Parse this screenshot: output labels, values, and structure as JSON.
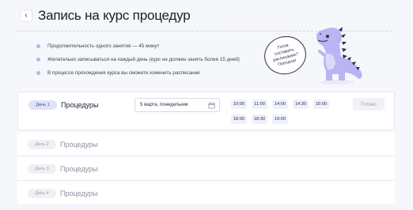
{
  "header": {
    "back_icon": "chevron-left-icon",
    "title": "Запись на курс процедур"
  },
  "info": [
    {
      "text": "Продолжительность одного занятия — 45 минут"
    },
    {
      "text": "Желательно записываться на каждый день  (курс не должен занять более 15 дней)"
    },
    {
      "text": "В процессе прохождения курса вы сможете изменить расписание"
    }
  ],
  "mascot": {
    "bubble_text": "Готов\nсоставить\nрасписание?\nПоехали!"
  },
  "rows": [
    {
      "day": "День 1",
      "label": "Процедуры",
      "date": "5 марта, понедельник",
      "times": [
        "10:00",
        "11:00",
        "14:00",
        "14:30",
        "16:00",
        "18:00",
        "18:30",
        "19:00"
      ],
      "done": "Готово"
    },
    {
      "day": "День 2",
      "label": "Процедуры"
    },
    {
      "day": "День 3",
      "label": "Процедуры"
    },
    {
      "day": "День 4",
      "label": "Процедуры"
    }
  ],
  "colors": {
    "accent": "#b7b4ea",
    "dino_body": "#b9b4f2",
    "dino_spikes": "#2d3048",
    "badge_active": "#dfe3f8",
    "time_chip": "#eef1fb"
  }
}
